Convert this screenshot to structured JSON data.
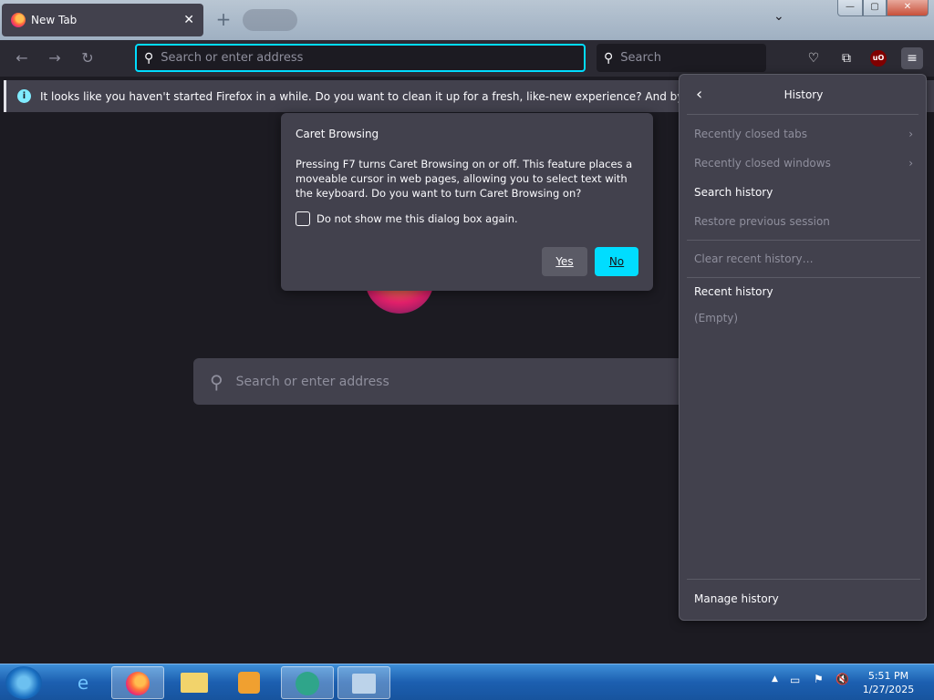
{
  "tab": {
    "title": "New Tab",
    "close": "✕"
  },
  "tabstrip": {
    "new_tab": "+",
    "list_all": "⌄",
    "min": "—",
    "max": "▢",
    "close": "✕"
  },
  "nav": {
    "back": "←",
    "forward": "→",
    "reload": "↻"
  },
  "urlbar": {
    "placeholder": "Search or enter address"
  },
  "searchbar": {
    "placeholder": "Search"
  },
  "toolbar": {
    "pocket": "♡",
    "extensions": "⧉",
    "ublock": "uO",
    "menu": "≡"
  },
  "notification": {
    "text": "It looks like you haven't started Firefox in a while. Do you want to clean it up for a fresh, like-new experience? And by the way, welcome back!"
  },
  "newtab": {
    "search_placeholder": "Search or enter address"
  },
  "dialog": {
    "title": "Caret Browsing",
    "body": "Pressing F7 turns Caret Browsing on or off. This feature places a moveable cursor in web pages, allowing you to select text with the keyboard. Do you want to turn Caret Browsing on?",
    "checkbox_label": "Do not show me this dialog box again.",
    "yes_label": "Yes",
    "no_label": "No"
  },
  "history_panel": {
    "title": "History",
    "back": "‹",
    "items": [
      {
        "label": "Recently closed tabs",
        "chevron": "›"
      },
      {
        "label": "Recently closed windows",
        "chevron": "›"
      },
      {
        "label": "Search history"
      },
      {
        "label": "Restore previous session"
      },
      {
        "label": "Clear recent history…"
      }
    ],
    "recent_heading": "Recent history",
    "empty": "(Empty)",
    "manage": "Manage history"
  },
  "taskbar": {
    "apps": [
      "ie",
      "firefox",
      "explorer",
      "media-player",
      "app5",
      "app6"
    ],
    "time": "5:51 PM",
    "date": "1/27/2025"
  },
  "colors": {
    "accent": "#00ddff",
    "panel": "#42414d",
    "background": "#1c1b22"
  }
}
